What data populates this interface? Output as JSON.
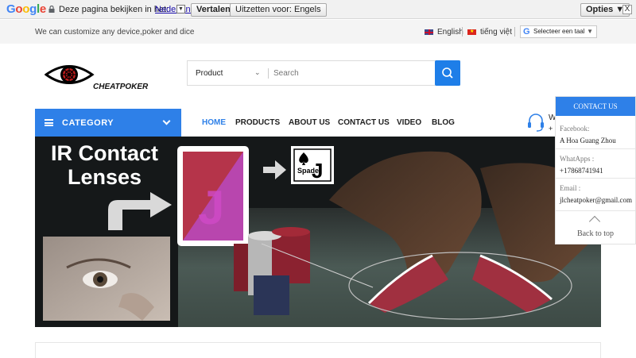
{
  "translate_bar": {
    "logo": [
      "G",
      "o",
      "o",
      "g",
      "l",
      "e"
    ],
    "prompt": "Deze pagina bekijken in het:",
    "language": "Nederlands",
    "translate_button": "Vertalen",
    "never_button": "Uitzetten voor: Engels",
    "options_button": "Opties ▼",
    "close": "X"
  },
  "topbar": {
    "tagline": "We can customize any device,poker and dice",
    "lang_en": "English",
    "lang_vi": "tiếng việt",
    "google_select": "Selecteer een taal"
  },
  "logo": {
    "text": "CHEATPOKER"
  },
  "search": {
    "category": "Product",
    "placeholder": "Search"
  },
  "nav": {
    "category_label": "CATEGORY",
    "items": [
      "HOME",
      "PRODUCTS",
      "ABOUT US",
      "CONTACT US",
      "VIDEO",
      "BLOG"
    ],
    "whatsapp_partial_1": "W",
    "whatsapp_partial_2": "+"
  },
  "banner": {
    "title_line1": "IR Contact",
    "title_line2": "Lenses",
    "spade_label": "Spade"
  },
  "contact": {
    "header": "CONTACT US",
    "facebook_label": "Facebook:",
    "facebook_value": "A Hoa Guang Zhou",
    "whatsapp_label": "WhatApps :",
    "whatsapp_value": "+17868741941",
    "email_label": "Email :",
    "email_value": "jlcheatpoker@gmail.com",
    "back_to_top": "Back to top"
  },
  "colors": {
    "accent": "#2e80e8",
    "search_button": "#1e7ee8"
  }
}
